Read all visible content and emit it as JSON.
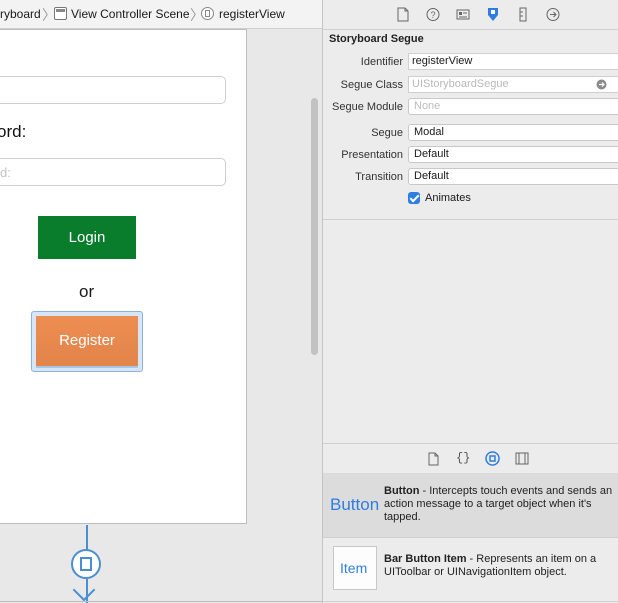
{
  "breadcrumb": {
    "items": [
      {
        "label": "ryboard"
      },
      {
        "label": "View Controller Scene"
      },
      {
        "label": "registerView"
      }
    ]
  },
  "canvas": {
    "password_label": "ord:",
    "password_placeholder": "d:",
    "login_label": "Login",
    "or_label": "or",
    "register_label": "Register"
  },
  "inspector": {
    "tabs": [
      "file-icon",
      "help-icon",
      "identity-icon",
      "attributes-icon",
      "size-icon",
      "connections-icon"
    ],
    "section_title": "Storyboard Segue",
    "identifier_label": "Identifier",
    "identifier_value": "registerView",
    "segue_class_label": "Segue Class",
    "segue_class_placeholder": "UIStoryboardSegue",
    "segue_module_label": "Segue Module",
    "segue_module_value": "None",
    "segue_label": "Segue",
    "segue_value": "Modal",
    "presentation_label": "Presentation",
    "presentation_value": "Default",
    "transition_label": "Transition",
    "transition_value": "Default",
    "animates_label": "Animates",
    "animates_checked": true
  },
  "library": {
    "tabs": [
      "file-template-icon",
      "code-snippet-icon",
      "object-library-icon",
      "media-library-icon"
    ],
    "items": [
      {
        "icon_text": "Button",
        "title": "Button",
        "desc": " - Intercepts touch events and sends an action message to a target object when it's tapped."
      },
      {
        "icon_text": "Item",
        "title": "Bar Button Item",
        "desc": " - Represents an item on a UIToolbar or UINavigationItem object."
      }
    ]
  },
  "colors": {
    "accent": "#2f7de1",
    "login": "#0a7d2c",
    "register": "#e8894f"
  }
}
